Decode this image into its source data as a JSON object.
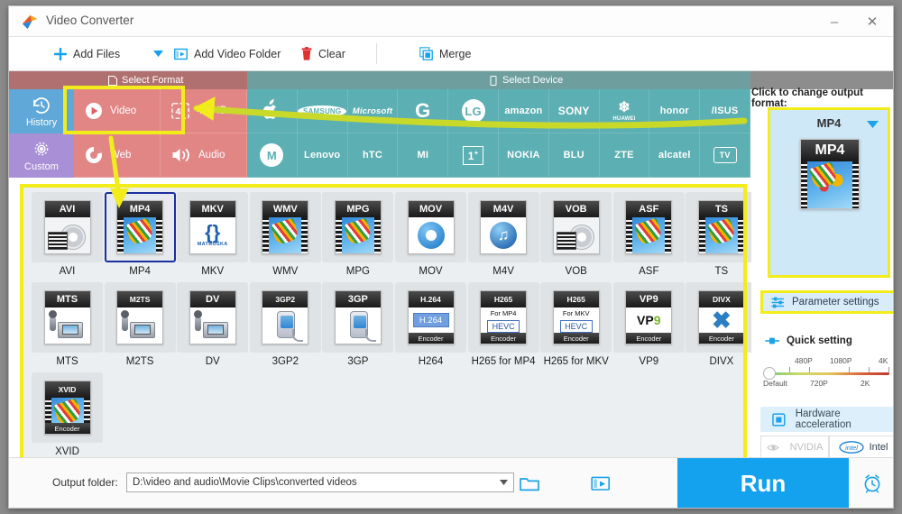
{
  "window": {
    "title": "Video Converter",
    "minimize": "–",
    "close": "✕"
  },
  "toolbar": {
    "add_files": "Add Files",
    "add_video_folder": "Add Video Folder",
    "clear": "Clear",
    "merge": "Merge"
  },
  "category_headers": {
    "select_format": "Select Format",
    "select_device": "Select Device"
  },
  "sidebar": {
    "items": [
      {
        "label": "History",
        "icon": "history-icon"
      },
      {
        "label": "Custom",
        "icon": "gear-icon"
      }
    ]
  },
  "format_categories": [
    {
      "label": "Video",
      "icon": "play-circle-icon",
      "selected": true
    },
    {
      "label": "4K/HD",
      "icon": "4k-icon",
      "selected": false
    },
    {
      "label": "Web",
      "icon": "chrome-icon",
      "selected": false
    },
    {
      "label": "Audio",
      "icon": "speaker-icon",
      "selected": false
    }
  ],
  "devices": [
    {
      "label": "Apple",
      "glyph": "",
      "kind": "apple"
    },
    {
      "label": "SAMSUNG",
      "glyph": "SAMSUNG",
      "kind": "oval"
    },
    {
      "label": "Microsoft",
      "glyph": "Microsoft",
      "kind": "text-italic"
    },
    {
      "label": "Google",
      "glyph": "G",
      "kind": "big"
    },
    {
      "label": "LG",
      "glyph": "LG",
      "kind": "circle"
    },
    {
      "label": "amazon",
      "glyph": "amazon",
      "kind": "text"
    },
    {
      "label": "SONY",
      "glyph": "SONY",
      "kind": "serif"
    },
    {
      "label": "HUAWEI",
      "glyph": "HUAWEI",
      "kind": "huawei"
    },
    {
      "label": "honor",
      "glyph": "honor",
      "kind": "text"
    },
    {
      "label": "ASUS",
      "glyph": "/ISUS",
      "kind": "text"
    },
    {
      "label": "Motorola",
      "glyph": "M",
      "kind": "circle"
    },
    {
      "label": "Lenovo",
      "glyph": "Lenovo",
      "kind": "text"
    },
    {
      "label": "HTC",
      "glyph": "hTC",
      "kind": "text"
    },
    {
      "label": "Mi",
      "glyph": "MI",
      "kind": "text"
    },
    {
      "label": "OnePlus",
      "glyph": "1",
      "kind": "boxed"
    },
    {
      "label": "NOKIA",
      "glyph": "NOKIA",
      "kind": "text"
    },
    {
      "label": "BLU",
      "glyph": "BLU",
      "kind": "text"
    },
    {
      "label": "ZTE",
      "glyph": "ZTE",
      "kind": "text"
    },
    {
      "label": "alcatel",
      "glyph": "alcatel",
      "kind": "text"
    },
    {
      "label": "TV",
      "glyph": "TV",
      "kind": "tv"
    }
  ],
  "formats": [
    {
      "label": "AVI",
      "badge": "AVI",
      "sub": "",
      "foot": "",
      "art": "disc",
      "selected": false
    },
    {
      "label": "MP4",
      "badge": "MP4",
      "sub": "",
      "foot": "",
      "art": "balloon",
      "selected": true
    },
    {
      "label": "MKV",
      "badge": "MKV",
      "sub": "",
      "foot": "",
      "art": "mkv",
      "selected": false
    },
    {
      "label": "WMV",
      "badge": "WMV",
      "sub": "",
      "foot": "",
      "art": "balloon",
      "selected": false
    },
    {
      "label": "MPG",
      "badge": "MPG",
      "sub": "",
      "foot": "",
      "art": "balloon",
      "selected": false
    },
    {
      "label": "MOV",
      "badge": "MOV",
      "sub": "",
      "foot": "",
      "art": "qt",
      "selected": false
    },
    {
      "label": "M4V",
      "badge": "M4V",
      "sub": "",
      "foot": "",
      "art": "note",
      "selected": false
    },
    {
      "label": "VOB",
      "badge": "VOB",
      "sub": "",
      "foot": "",
      "art": "disc",
      "selected": false
    },
    {
      "label": "ASF",
      "badge": "ASF",
      "sub": "",
      "foot": "",
      "art": "balloon",
      "selected": false
    },
    {
      "label": "TS",
      "badge": "TS",
      "sub": "",
      "foot": "",
      "art": "balloon",
      "selected": false
    },
    {
      "label": "MTS",
      "badge": "MTS",
      "sub": "",
      "foot": "",
      "art": "cam",
      "selected": false
    },
    {
      "label": "M2TS",
      "badge": "M2TS",
      "sub": "",
      "foot": "",
      "art": "cam",
      "selected": false
    },
    {
      "label": "DV",
      "badge": "DV",
      "sub": "",
      "foot": "",
      "art": "cam",
      "selected": false
    },
    {
      "label": "3GP2",
      "badge": "3GP2",
      "sub": "",
      "foot": "",
      "art": "phone",
      "selected": false
    },
    {
      "label": "3GP",
      "badge": "3GP",
      "sub": "",
      "foot": "",
      "art": "phone",
      "selected": false
    },
    {
      "label": "H264",
      "badge": "H.264",
      "sub": "",
      "foot": "Encoder",
      "art": "h264",
      "selected": false
    },
    {
      "label": "H265 for MP4",
      "badge": "H265",
      "sub": "For MP4",
      "foot": "Encoder",
      "art": "hevc",
      "selected": false
    },
    {
      "label": "H265 for MKV",
      "badge": "H265",
      "sub": "For MKV",
      "foot": "Encoder",
      "art": "hevc",
      "selected": false
    },
    {
      "label": "VP9",
      "badge": "VP9",
      "sub": "",
      "foot": "Encoder",
      "art": "vp9",
      "selected": false
    },
    {
      "label": "DIVX",
      "badge": "DIVX",
      "sub": "",
      "foot": "Encoder",
      "art": "divx",
      "selected": false
    },
    {
      "label": "XVID",
      "badge": "XVID",
      "sub": "",
      "foot": "Encoder",
      "art": "balloon",
      "selected": false
    }
  ],
  "right_panel": {
    "caption": "Click to change output format:",
    "output_format": "MP4",
    "thumb_badge": "MP4",
    "parameter_settings": "Parameter settings",
    "quick_setting": "Quick setting",
    "slider": {
      "value": "Default",
      "top_ticks": [
        "480P",
        "1080P",
        "4K"
      ],
      "bottom_ticks": [
        "Default",
        "720P",
        "2K"
      ]
    },
    "hardware_acceleration": "Hardware acceleration",
    "gpu_nvidia": "NVIDIA",
    "gpu_intel": "Intel",
    "gpu_intel_badge": "intel"
  },
  "bottom": {
    "output_folder_label": "Output folder:",
    "output_folder_value": "D:\\video and audio\\Movie Clips\\converted videos",
    "run": "Run"
  },
  "colors": {
    "accent_blue": "#14a2ef",
    "highlight_yellow": "#f2ed1a",
    "format_red": "#e28585",
    "device_teal": "#5cafb2",
    "history_blue": "#5fa8d8",
    "custom_purple": "#a98fd6",
    "selection_border": "#1b2f9e"
  }
}
